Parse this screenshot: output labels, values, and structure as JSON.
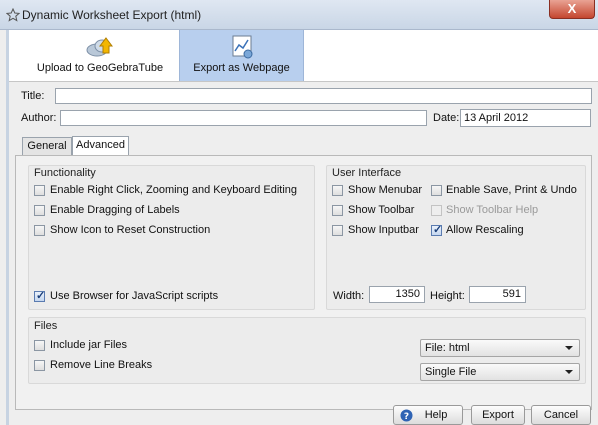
{
  "window": {
    "title": "Dynamic Worksheet Export (html)",
    "close_label": "X"
  },
  "toolbar": {
    "upload_label": "Upload to GeoGebraTube",
    "export_label": "Export as Webpage"
  },
  "form": {
    "title_label": "Title:",
    "title_value": "",
    "author_label": "Author:",
    "author_value": "",
    "date_label": "Date:",
    "date_value": "13 April 2012"
  },
  "tabs": [
    {
      "label": "General",
      "active": false
    },
    {
      "label": "Advanced",
      "active": true
    }
  ],
  "functionality": {
    "title": "Functionality",
    "items": [
      {
        "label": "Enable Right Click, Zooming and Keyboard Editing",
        "checked": false
      },
      {
        "label": "Enable Dragging of Labels",
        "checked": false
      },
      {
        "label": "Show Icon to Reset Construction",
        "checked": false
      },
      {
        "label": "Use Browser for JavaScript scripts",
        "checked": true
      }
    ]
  },
  "user_interface": {
    "title": "User Interface",
    "items": [
      {
        "label": "Show Menubar",
        "checked": false,
        "enabled": true
      },
      {
        "label": "Enable Save, Print & Undo",
        "checked": false,
        "enabled": true
      },
      {
        "label": "Show Toolbar",
        "checked": false,
        "enabled": true
      },
      {
        "label": "Show Toolbar Help",
        "checked": false,
        "enabled": false
      },
      {
        "label": "Show Inputbar",
        "checked": false,
        "enabled": true
      },
      {
        "label": "Allow Rescaling",
        "checked": true,
        "enabled": true
      }
    ],
    "width_label": "Width:",
    "width_value": "1350",
    "height_label": "Height:",
    "height_value": "591"
  },
  "files": {
    "title": "Files",
    "items": [
      {
        "label": "Include jar Files",
        "checked": false
      },
      {
        "label": "Remove Line Breaks",
        "checked": false
      }
    ],
    "file_type_selected": "File: html",
    "file_mode_selected": "Single File"
  },
  "buttons": {
    "help": "Help",
    "export": "Export",
    "cancel": "Cancel"
  },
  "icons": {
    "window": "geogebra-star-icon",
    "upload": "upload-cloud-icon",
    "export": "webpage-export-icon",
    "help": "help-icon"
  },
  "colors": {
    "selected_tool_bg": "#b8cfee",
    "close_button": "#c4462f"
  }
}
